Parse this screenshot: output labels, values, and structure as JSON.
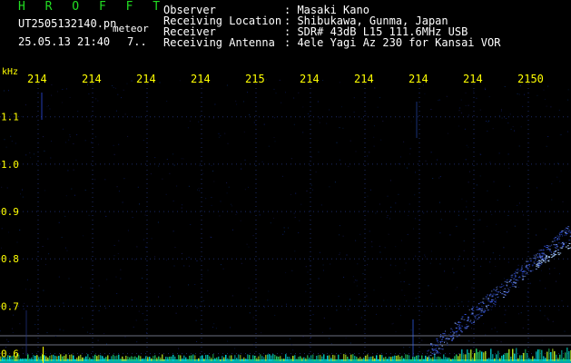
{
  "header": {
    "app_title": "H R O F F T",
    "file_name": "UT2505132140.pn",
    "mode": "meteor",
    "date_time": "25.05.13 21:40",
    "extra": "7..",
    "info": [
      {
        "key": "Observer",
        "value": ": Masaki Kano"
      },
      {
        "key": "Receiving Location",
        "value": ": Shibukawa, Gunma, Japan"
      },
      {
        "key": "Receiver",
        "value": ": SDR# 43dB L15 111.6MHz USB"
      },
      {
        "key": "Receiving Antenna",
        "value": ": 4ele Yagi Az 230 for Kansai VOR"
      }
    ]
  },
  "spectrogram": {
    "y_unit": "kHz",
    "y_ticks": [
      "1.1",
      "1.0",
      "0.9",
      "0.8",
      "0.7",
      "0.6"
    ],
    "y_range": [
      0.58,
      1.18
    ],
    "x_ticks": [
      "214",
      "214",
      "214",
      "214",
      "215",
      "214",
      "214",
      "214",
      "214",
      "2150"
    ],
    "colors": {
      "background": "#000000",
      "grid": "#1c2a66",
      "axis_text": "#ffff00",
      "trace": "#4466ff",
      "baseline": "#00c8c8"
    }
  }
}
